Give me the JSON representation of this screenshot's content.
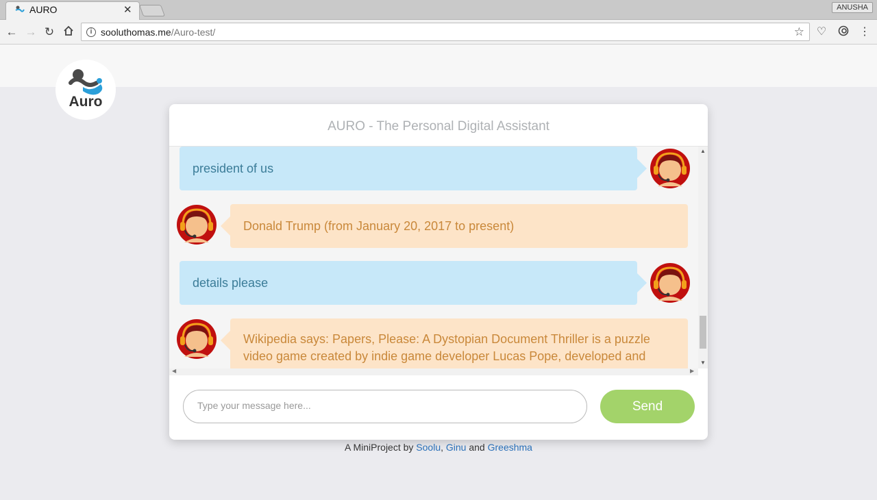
{
  "browser": {
    "tab_title": "AURO",
    "tab_close": "✕",
    "user_name": "ANUSHA",
    "url_host": "sooluthomas.me",
    "url_path": "/Auro-test/"
  },
  "page": {
    "logo_text": "Auro",
    "chat_title": "AURO - The Personal Digital Assistant",
    "messages": [
      {
        "sender": "user",
        "text": "president of us"
      },
      {
        "sender": "bot",
        "text": "Donald Trump (from January 20, 2017 to present)"
      },
      {
        "sender": "user",
        "text": "details please"
      },
      {
        "sender": "bot",
        "text": "Wikipedia says: Papers, Please: A Dystopian Document Thriller is a puzzle video game created by indie game developer Lucas Pope, developed and"
      }
    ],
    "input_placeholder": "Type your message here...",
    "send_label": "Send",
    "footer": {
      "prefix": "A MiniProject by ",
      "author1": "Soolu",
      "sep1": ", ",
      "author2": "Ginu",
      "sep2": " and ",
      "author3": "Greeshma"
    }
  },
  "colors": {
    "user_bubble": "#c7e8f9",
    "bot_bubble": "#fde4c8",
    "send_button": "#a3d36a"
  }
}
